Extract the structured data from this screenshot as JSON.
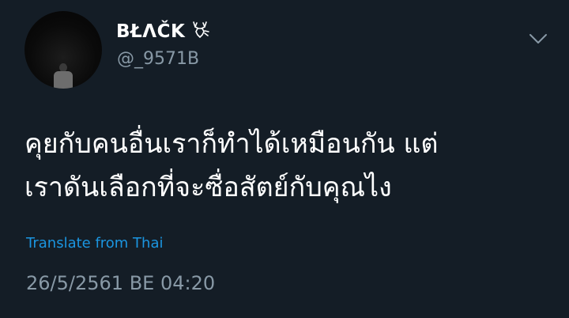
{
  "user": {
    "display_name": "BŁΛČK",
    "handle": "@_9571B",
    "avatar_icon": "avatar-photo-figure",
    "badge_icon": "deer-icon"
  },
  "header": {
    "more_icon": "chevron-down-icon"
  },
  "tweet": {
    "lines": [
      "คุยกับคนอื่นเราก็ทำได้เหมือนกัน แต่",
      "เราดันเลือกที่จะซื่อสัตย์กับคุณไง"
    ],
    "translate_label": "Translate from Thai",
    "timestamp": "26/5/2561 BE 04:20"
  },
  "colors": {
    "background": "#141d26",
    "text": "#ffffff",
    "secondary": "#8899a6",
    "link": "#1b95e0"
  }
}
